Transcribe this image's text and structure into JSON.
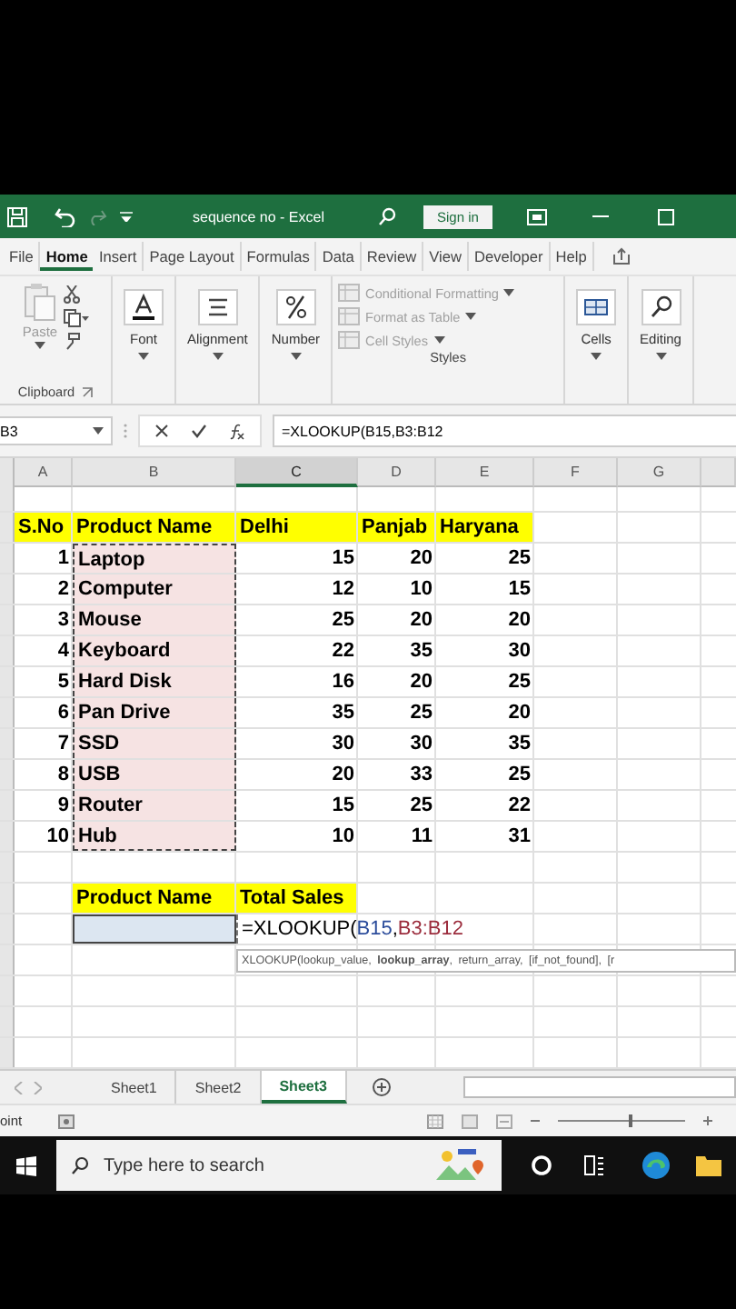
{
  "window": {
    "title": "sequence no  -  Excel",
    "sign_in": "Sign in"
  },
  "tabs": [
    {
      "label": "File",
      "selected": false
    },
    {
      "label": "Home",
      "selected": true
    },
    {
      "label": "Insert",
      "selected": false
    },
    {
      "label": "Page Layout",
      "selected": false
    },
    {
      "label": "Formulas",
      "selected": false
    },
    {
      "label": "Data",
      "selected": false
    },
    {
      "label": "Review",
      "selected": false
    },
    {
      "label": "View",
      "selected": false
    },
    {
      "label": "Developer",
      "selected": false
    },
    {
      "label": "Help",
      "selected": false
    }
  ],
  "ribbon": {
    "groups": [
      {
        "kind": "clipboard",
        "label": "Clipboard",
        "paste": {
          "label": "Paste",
          "disabled": true
        }
      },
      {
        "kind": "collapsed",
        "label": "Font"
      },
      {
        "kind": "collapsed",
        "label": "Alignment"
      },
      {
        "kind": "collapsed",
        "label": "Number"
      },
      {
        "kind": "styles",
        "label": "Styles",
        "items": [
          {
            "label": "Conditional Formatting",
            "disabled": true
          },
          {
            "label": "Format as Table",
            "disabled": true
          },
          {
            "label": "Cell Styles",
            "disabled": true
          }
        ]
      },
      {
        "kind": "collapsed",
        "label": "Cells"
      },
      {
        "kind": "collapsed",
        "label": "Editing"
      }
    ]
  },
  "formula_bar": {
    "name_box": "B3",
    "formula": "=XLOOKUP(B15,B3:B12"
  },
  "columns": [
    {
      "label": "A",
      "selected": false
    },
    {
      "label": "B",
      "selected": false
    },
    {
      "label": "C",
      "selected": true
    },
    {
      "label": "D",
      "selected": false
    },
    {
      "label": "E",
      "selected": false
    },
    {
      "label": "F",
      "selected": false
    },
    {
      "label": "G",
      "selected": false
    }
  ],
  "rows": [
    {
      "kind": "blank"
    },
    {
      "kind": "header",
      "cells": [
        "S.No",
        "Product Name",
        "Delhi",
        "Panjab",
        "Haryana"
      ]
    },
    {
      "kind": "data",
      "cells": [
        "1",
        "Laptop",
        "15",
        "20",
        "25"
      ]
    },
    {
      "kind": "data",
      "cells": [
        "2",
        "Computer",
        "12",
        "10",
        "15"
      ]
    },
    {
      "kind": "data",
      "cells": [
        "3",
        "Mouse",
        "25",
        "20",
        "20"
      ]
    },
    {
      "kind": "data",
      "cells": [
        "4",
        "Keyboard",
        "22",
        "35",
        "30"
      ]
    },
    {
      "kind": "data",
      "cells": [
        "5",
        "Hard Disk",
        "16",
        "20",
        "25"
      ]
    },
    {
      "kind": "data",
      "cells": [
        "6",
        "Pan Drive",
        "35",
        "25",
        "20"
      ]
    },
    {
      "kind": "data",
      "cells": [
        "7",
        "SSD",
        "30",
        "30",
        "35"
      ]
    },
    {
      "kind": "data",
      "cells": [
        "8",
        "USB",
        "20",
        "33",
        "25"
      ]
    },
    {
      "kind": "data",
      "cells": [
        "9",
        "Router",
        "15",
        "25",
        "22"
      ]
    },
    {
      "kind": "data",
      "cells": [
        "10",
        "Hub",
        "10",
        "11",
        "31"
      ]
    },
    {
      "kind": "blank"
    },
    {
      "kind": "summary_header",
      "cells": [
        "Product Name",
        "Total Sales"
      ]
    },
    {
      "kind": "formula",
      "parts": [
        {
          "text": "=XLOOKUP("
        },
        {
          "text": "B15",
          "color": "#2b4c9b"
        },
        {
          "text": ","
        },
        {
          "text": "B3:B12",
          "color": "#9b2c3c"
        }
      ]
    },
    {
      "kind": "tooltip",
      "text": "XLOOKUP(lookup_value, **lookup_array**, return_array, [if_not_found], [r"
    },
    {
      "kind": "blank"
    },
    {
      "kind": "blank"
    },
    {
      "kind": "blank"
    }
  ],
  "sheet_tabs": [
    {
      "label": "Sheet1",
      "selected": false
    },
    {
      "label": "Sheet2",
      "selected": false
    },
    {
      "label": "Sheet3",
      "selected": true
    }
  ],
  "status_bar": {
    "mode": "oint",
    "zoom": {
      "level": 0.55
    }
  },
  "taskbar": {
    "search_placeholder": "Type here to search"
  }
}
